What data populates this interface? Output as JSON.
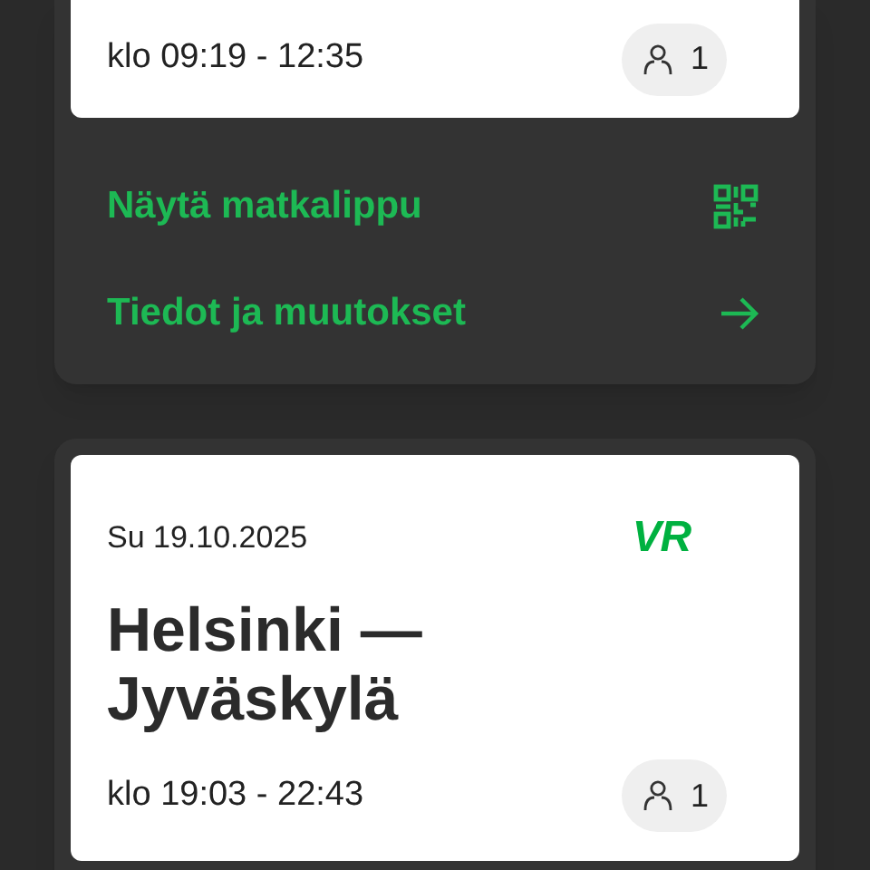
{
  "trips": [
    {
      "time": "klo 09:19 - 12:35",
      "passengers": "1",
      "actions": [
        {
          "label": "Näytä matkalippu",
          "kind": "qr"
        },
        {
          "label": "Tiedot ja muutokset",
          "kind": "arrow"
        }
      ]
    },
    {
      "date": "Su 19.10.2025",
      "route": "Helsinki — Jyväskylä",
      "logo": "VR",
      "time": "klo 19:03 - 22:43",
      "passengers": "1"
    }
  ]
}
